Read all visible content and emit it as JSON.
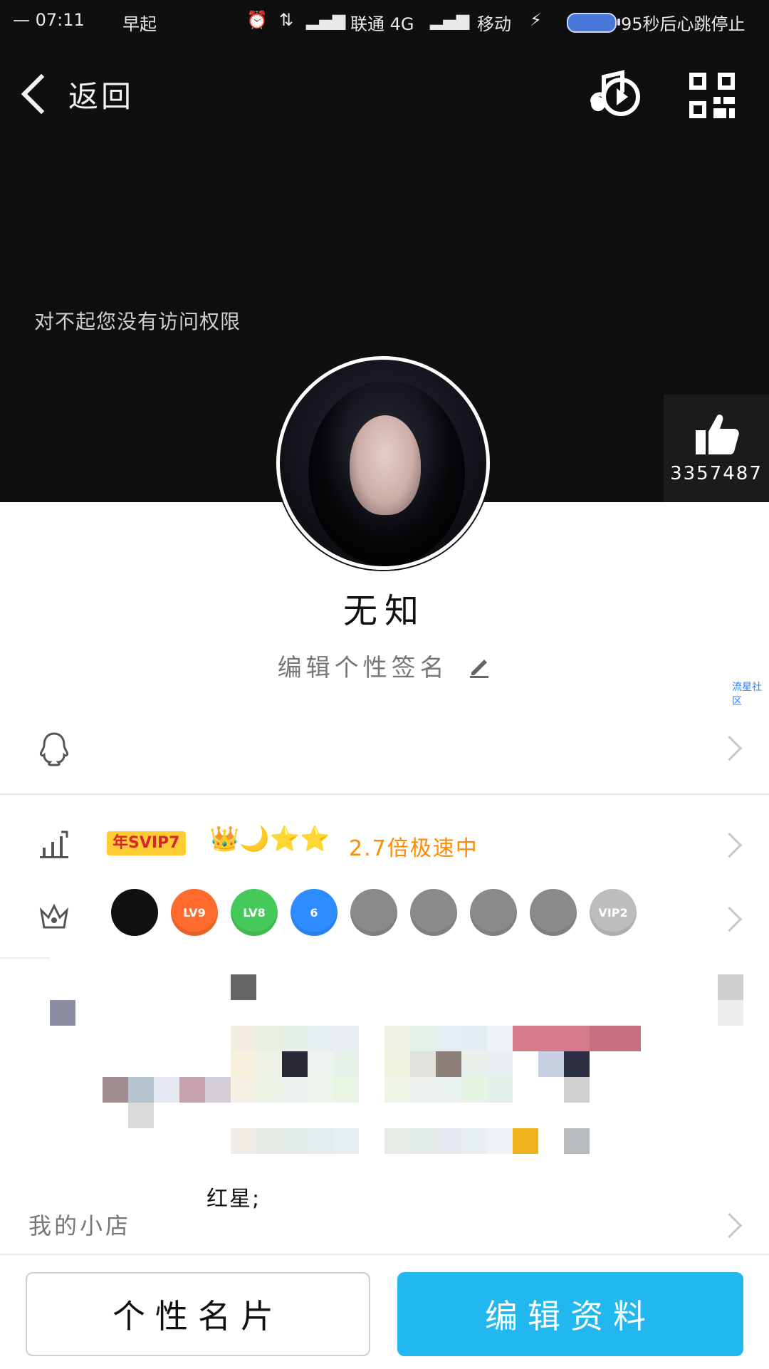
{
  "status_bar": {
    "time": "— 07:11",
    "note": "早起",
    "carrier1": "联通 4G",
    "carrier2": "移动",
    "heartbeat": "95秒后心跳停止"
  },
  "nav": {
    "back_label": "返回"
  },
  "header": {
    "no_access_text": "对不起您没有访问权限",
    "likes_count": "3357487"
  },
  "profile": {
    "name": "无知",
    "signature": "编辑个性签名",
    "watermark": "流星社区"
  },
  "vip": {
    "badge": "年SVIP7",
    "icons": "👑🌙⭐⭐",
    "speed": "2.7倍极速中"
  },
  "badges": [
    {
      "label": "",
      "color": "#111111"
    },
    {
      "label": "LV9",
      "color": "#ff6b2c"
    },
    {
      "label": "LV8",
      "color": "#45c95a"
    },
    {
      "label": "6",
      "color": "#2d8cff"
    },
    {
      "label": "",
      "color": "#8a8a8a"
    },
    {
      "label": "",
      "color": "#8a8a8a"
    },
    {
      "label": "",
      "color": "#8a8a8a"
    },
    {
      "label": "",
      "color": "#8a8a8a"
    },
    {
      "label": "VIP2",
      "color": "#bdbdbd"
    }
  ],
  "shop": {
    "label": "我的小店",
    "stars_label": "红星;"
  },
  "bottom": {
    "card_label": "个性名片",
    "edit_label": "编辑资料"
  },
  "colors": {
    "header_bg": "#0f0f0f",
    "accent_blue": "#22b7ee",
    "speed_orange": "#ff8a00"
  }
}
